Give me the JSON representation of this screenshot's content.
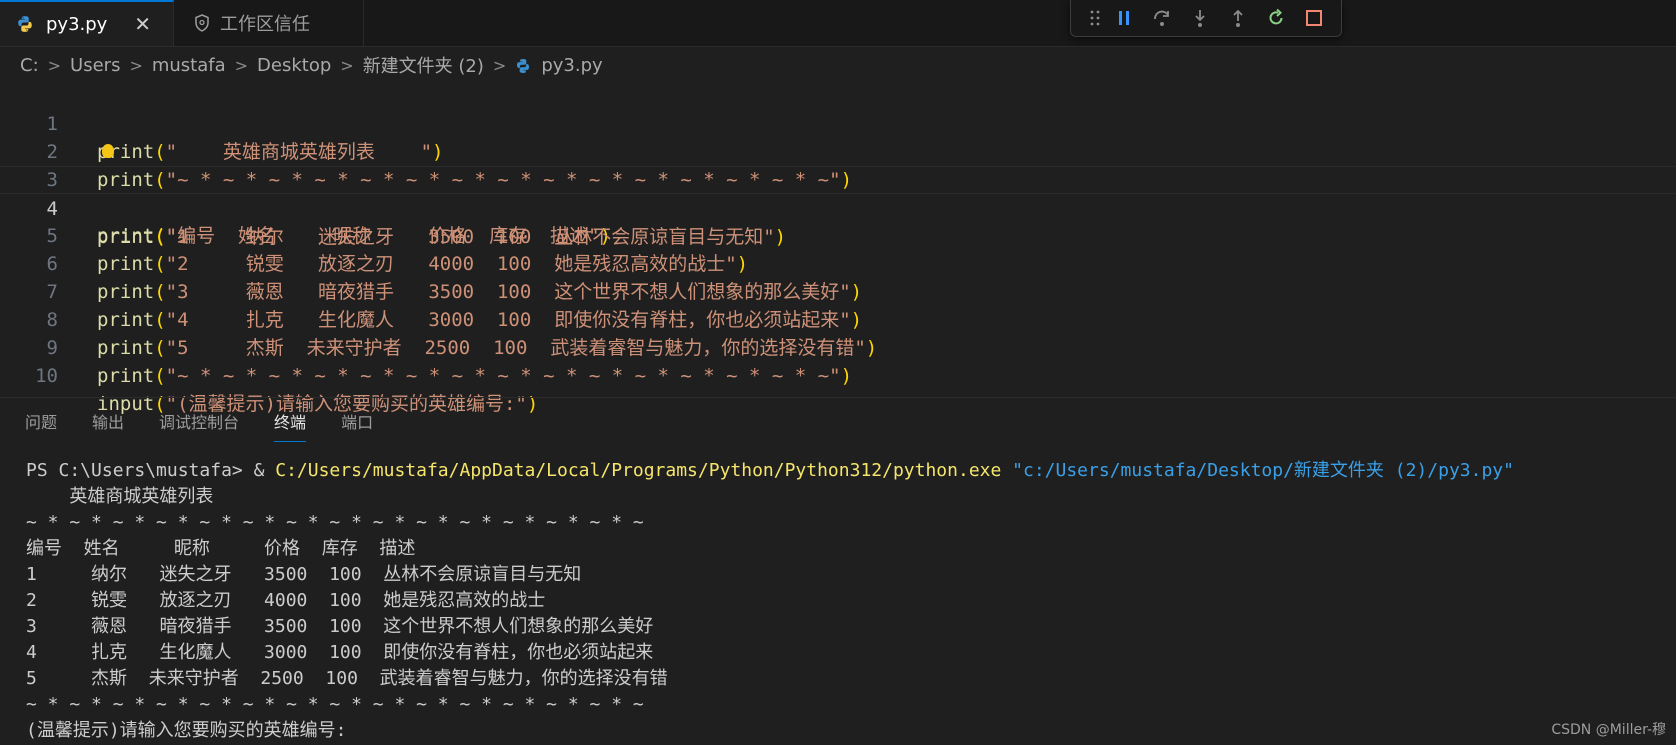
{
  "tabs": {
    "active": {
      "label": "py3.py",
      "close": "✕"
    },
    "inactive": {
      "label": "工作区信任"
    }
  },
  "breadcrumb": {
    "items": [
      "C:",
      "Users",
      "mustafa",
      "Desktop",
      "新建文件夹 (2)"
    ],
    "file": "py3.py",
    "separator": ">"
  },
  "editor": {
    "lines": [
      {
        "num": "1",
        "fn": "print",
        "text": "\"    英雄商城英雄列表    \""
      },
      {
        "num": "2",
        "fn": "print",
        "text": "\"~ * ~ * ~ * ~ * ~ * ~ * ~ * ~ * ~ * ~ * ~ * ~ * ~ * ~ * ~\""
      },
      {
        "num": "3",
        "fn": "print",
        "text": "\"编号  姓名     昵称     价格  库存  描述\""
      },
      {
        "num": "4",
        "fn": "print",
        "text": "\"1     纳尔   迷失之牙   3500  100  丛林不会原谅盲目与无知\""
      },
      {
        "num": "5",
        "fn": "print",
        "text": "\"2     锐雯   放逐之刃   4000  100  她是残忍高效的战士\""
      },
      {
        "num": "6",
        "fn": "print",
        "text": "\"3     薇恩   暗夜猎手   3500  100  这个世界不想人们想象的那么美好\""
      },
      {
        "num": "7",
        "fn": "print",
        "text": "\"4     扎克   生化魔人   3000  100  即使你没有脊柱，你也必须站起来\""
      },
      {
        "num": "8",
        "fn": "print",
        "text": "\"5     杰斯  未来守护者  2500  100  武装着睿智与魅力，你的选择没有错\""
      },
      {
        "num": "9",
        "fn": "print",
        "text": "\"~ * ~ * ~ * ~ * ~ * ~ * ~ * ~ * ~ * ~ * ~ * ~ * ~ * ~ * ~\""
      },
      {
        "num": "10",
        "fn": "input",
        "text": "\"(温馨提示)请输入您要购买的英雄编号:\""
      }
    ]
  },
  "panel": {
    "tabs": [
      "问题",
      "输出",
      "调试控制台",
      "终端",
      "端口"
    ],
    "active_tab": "终端"
  },
  "terminal": {
    "prompt": "PS C:\\Users\\mustafa> & ",
    "exe": "C:/Users/mustafa/AppData/Local/Programs/Python/Python312/python.exe",
    "arg": " \"c:/Users/mustafa/Desktop/新建文件夹 (2)/py3.py\"",
    "output": [
      "    英雄商城英雄列表",
      "~ * ~ * ~ * ~ * ~ * ~ * ~ * ~ * ~ * ~ * ~ * ~ * ~ * ~ * ~",
      "编号  姓名     昵称     价格  库存  描述",
      "1     纳尔   迷失之牙   3500  100  丛林不会原谅盲目与无知",
      "2     锐雯   放逐之刃   4000  100  她是残忍高效的战士",
      "3     薇恩   暗夜猎手   3500  100  这个世界不想人们想象的那么美好",
      "4     扎克   生化魔人   3000  100  即使你没有脊柱，你也必须站起来",
      "5     杰斯  未来守护者  2500  100  武装着睿智与魅力，你的选择没有错",
      "~ * ~ * ~ * ~ * ~ * ~ * ~ * ~ * ~ * ~ * ~ * ~ * ~ * ~ * ~",
      "(温馨提示)请输入您要购买的英雄编号:"
    ]
  },
  "watermark": "CSDN @Miller-穆",
  "debug_toolbar": {
    "buttons": [
      "pause-icon",
      "step-over-icon",
      "step-into-icon",
      "step-out-icon",
      "restart-icon",
      "stop-icon"
    ]
  },
  "colors": {
    "accent": "#0078d4",
    "function": "#dcdcaa",
    "string": "#ce9178",
    "bracket": "#ffd700",
    "terminal_exe": "#f5e56b",
    "terminal_arg": "#3aa0e8"
  }
}
